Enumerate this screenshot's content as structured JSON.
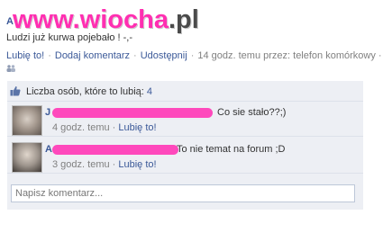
{
  "watermark": {
    "part1": "www.wioch",
    "part2": "a",
    "part3": ".pl"
  },
  "post": {
    "author": "A",
    "text": "Ludzi już kurwa pojebało ! -,-"
  },
  "actions": {
    "like": "Lubię to!",
    "comment": "Dodaj komentarz",
    "share": "Udostępnij",
    "meta": "14 godz. temu przez: telefon komórkowy ·"
  },
  "likes": {
    "label": "Liczba osób, które to lubią:",
    "count": "4"
  },
  "comments": [
    {
      "author": "J",
      "text": "Co sie stało??;)",
      "time": "4 godz. temu",
      "like": "Lubię to!"
    },
    {
      "author": "A",
      "text": "To nie temat na forum ;D",
      "time": "3 godz. temu",
      "like": "Lubię to!"
    }
  ],
  "composer": {
    "placeholder": "Napisz komentarz..."
  },
  "colors": {
    "link": "#3b5998",
    "panel": "#edeff4",
    "redaction": "#ff3fb8"
  }
}
